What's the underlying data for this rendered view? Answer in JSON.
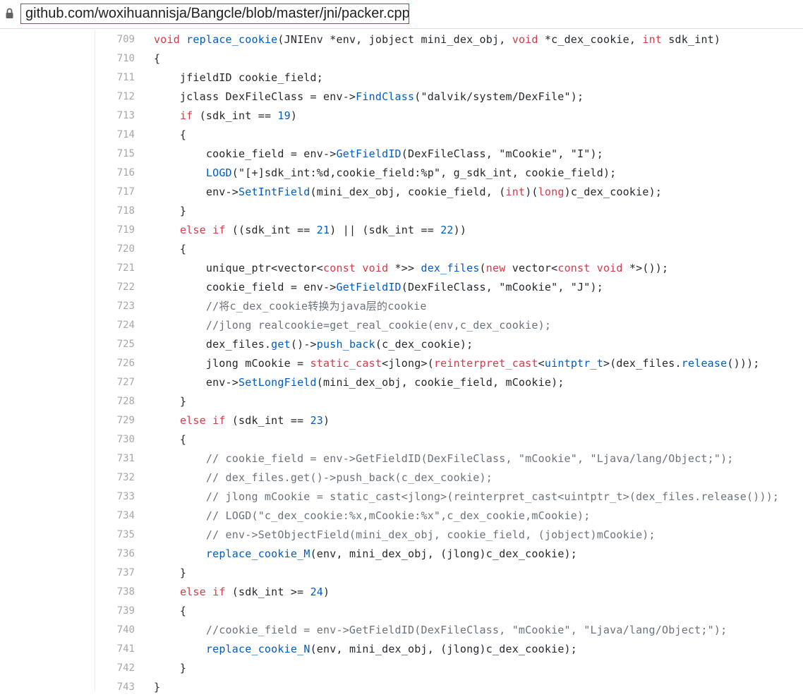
{
  "address_bar": {
    "url": "github.com/woxihuannisja/Bangcle/blob/master/jni/packer.cpp",
    "lock_icon": "lock-icon"
  },
  "code": {
    "lines": [
      {
        "n": "709",
        "tokens": [
          [
            "k",
            "void"
          ],
          [
            "p",
            " "
          ],
          [
            "f",
            "replace_cookie"
          ],
          [
            "p",
            "(JNIEnv *env, jobject mini_dex_obj, "
          ],
          [
            "k",
            "void"
          ],
          [
            "p",
            " *c_dex_cookie, "
          ],
          [
            "k",
            "int"
          ],
          [
            "p",
            " sdk_int)"
          ]
        ]
      },
      {
        "n": "710",
        "tokens": [
          [
            "p",
            "{"
          ]
        ]
      },
      {
        "n": "711",
        "tokens": [
          [
            "p",
            "    jfieldID cookie_field;"
          ]
        ]
      },
      {
        "n": "712",
        "tokens": [
          [
            "p",
            "    jclass DexFileClass = env->"
          ],
          [
            "f",
            "FindClass"
          ],
          [
            "p",
            "(\"dalvik/system/DexFile\");"
          ]
        ]
      },
      {
        "n": "713",
        "tokens": [
          [
            "p",
            "    "
          ],
          [
            "k",
            "if"
          ],
          [
            "p",
            " (sdk_int == "
          ],
          [
            "n",
            "19"
          ],
          [
            "p",
            ")"
          ]
        ]
      },
      {
        "n": "714",
        "tokens": [
          [
            "p",
            "    {"
          ]
        ]
      },
      {
        "n": "715",
        "tokens": [
          [
            "p",
            "        cookie_field = env->"
          ],
          [
            "f",
            "GetFieldID"
          ],
          [
            "p",
            "(DexFileClass, \"mCookie\", \"I\");"
          ]
        ]
      },
      {
        "n": "716",
        "tokens": [
          [
            "p",
            "        "
          ],
          [
            "f",
            "LOGD"
          ],
          [
            "p",
            "(\"[+]sdk_int:%d,cookie_field:%p\", g_sdk_int, cookie_field);"
          ]
        ]
      },
      {
        "n": "717",
        "tokens": [
          [
            "p",
            "        env->"
          ],
          [
            "f",
            "SetIntField"
          ],
          [
            "p",
            "(mini_dex_obj, cookie_field, ("
          ],
          [
            "k",
            "int"
          ],
          [
            "p",
            ")("
          ],
          [
            "k",
            "long"
          ],
          [
            "p",
            ")c_dex_cookie);"
          ]
        ]
      },
      {
        "n": "718",
        "tokens": [
          [
            "p",
            "    }"
          ]
        ]
      },
      {
        "n": "719",
        "tokens": [
          [
            "p",
            "    "
          ],
          [
            "k",
            "else if"
          ],
          [
            "p",
            " ((sdk_int == "
          ],
          [
            "n",
            "21"
          ],
          [
            "p",
            ") || (sdk_int == "
          ],
          [
            "n",
            "22"
          ],
          [
            "p",
            "))"
          ]
        ]
      },
      {
        "n": "720",
        "tokens": [
          [
            "p",
            "    {"
          ]
        ]
      },
      {
        "n": "721",
        "tokens": [
          [
            "p",
            "        unique_ptr<vector<"
          ],
          [
            "k",
            "const void"
          ],
          [
            "p",
            " *>> "
          ],
          [
            "f",
            "dex_files"
          ],
          [
            "p",
            "("
          ],
          [
            "k",
            "new"
          ],
          [
            "p",
            " vector<"
          ],
          [
            "k",
            "const void"
          ],
          [
            "p",
            " *>());"
          ]
        ]
      },
      {
        "n": "722",
        "tokens": [
          [
            "p",
            "        cookie_field = env->"
          ],
          [
            "f",
            "GetFieldID"
          ],
          [
            "p",
            "(DexFileClass, \"mCookie\", \"J\");"
          ]
        ]
      },
      {
        "n": "723",
        "tokens": [
          [
            "c",
            "        //将c_dex_cookie转换为java层的cookie"
          ]
        ]
      },
      {
        "n": "724",
        "tokens": [
          [
            "c",
            "        //jlong realcookie=get_real_cookie(env,c_dex_cookie);"
          ]
        ]
      },
      {
        "n": "725",
        "tokens": [
          [
            "p",
            "        dex_files."
          ],
          [
            "f",
            "get"
          ],
          [
            "p",
            "()->"
          ],
          [
            "f",
            "push_back"
          ],
          [
            "p",
            "(c_dex_cookie);"
          ]
        ]
      },
      {
        "n": "726",
        "tokens": [
          [
            "p",
            "        jlong mCookie = "
          ],
          [
            "k",
            "static_cast"
          ],
          [
            "p",
            "<jlong>("
          ],
          [
            "k",
            "reinterpret_cast"
          ],
          [
            "p",
            "<"
          ],
          [
            "f",
            "uintptr_t"
          ],
          [
            "p",
            ">(dex_files."
          ],
          [
            "f",
            "release"
          ],
          [
            "p",
            "()));"
          ]
        ]
      },
      {
        "n": "727",
        "tokens": [
          [
            "p",
            "        env->"
          ],
          [
            "f",
            "SetLongField"
          ],
          [
            "p",
            "(mini_dex_obj, cookie_field, mCookie);"
          ]
        ]
      },
      {
        "n": "728",
        "tokens": [
          [
            "p",
            "    }"
          ]
        ]
      },
      {
        "n": "729",
        "tokens": [
          [
            "p",
            "    "
          ],
          [
            "k",
            "else if"
          ],
          [
            "p",
            " (sdk_int == "
          ],
          [
            "n",
            "23"
          ],
          [
            "p",
            ")"
          ]
        ]
      },
      {
        "n": "730",
        "tokens": [
          [
            "p",
            "    {"
          ]
        ]
      },
      {
        "n": "731",
        "tokens": [
          [
            "c",
            "        // cookie_field = env->GetFieldID(DexFileClass, \"mCookie\", \"Ljava/lang/Object;\");"
          ]
        ]
      },
      {
        "n": "732",
        "tokens": [
          [
            "c",
            "        // dex_files.get()->push_back(c_dex_cookie);"
          ]
        ]
      },
      {
        "n": "733",
        "tokens": [
          [
            "c",
            "        // jlong mCookie = static_cast<jlong>(reinterpret_cast<uintptr_t>(dex_files.release()));"
          ]
        ]
      },
      {
        "n": "734",
        "tokens": [
          [
            "c",
            "        // LOGD(\"c_dex_cookie:%x,mCookie:%x\",c_dex_cookie,mCookie);"
          ]
        ]
      },
      {
        "n": "735",
        "tokens": [
          [
            "c",
            "        // env->SetObjectField(mini_dex_obj, cookie_field, (jobject)mCookie);"
          ]
        ]
      },
      {
        "n": "736",
        "tokens": [
          [
            "p",
            "        "
          ],
          [
            "f",
            "replace_cookie_M"
          ],
          [
            "p",
            "(env, mini_dex_obj, (jlong)c_dex_cookie);"
          ]
        ]
      },
      {
        "n": "737",
        "tokens": [
          [
            "p",
            "    }"
          ]
        ]
      },
      {
        "n": "738",
        "tokens": [
          [
            "p",
            "    "
          ],
          [
            "k",
            "else if"
          ],
          [
            "p",
            " (sdk_int >= "
          ],
          [
            "n",
            "24"
          ],
          [
            "p",
            ")"
          ]
        ]
      },
      {
        "n": "739",
        "tokens": [
          [
            "p",
            "    {"
          ]
        ]
      },
      {
        "n": "740",
        "tokens": [
          [
            "c",
            "        //cookie_field = env->GetFieldID(DexFileClass, \"mCookie\", \"Ljava/lang/Object;\");"
          ]
        ]
      },
      {
        "n": "741",
        "tokens": [
          [
            "p",
            "        "
          ],
          [
            "f",
            "replace_cookie_N"
          ],
          [
            "p",
            "(env, mini_dex_obj, (jlong)c_dex_cookie);"
          ]
        ]
      },
      {
        "n": "742",
        "tokens": [
          [
            "p",
            "    }"
          ]
        ]
      },
      {
        "n": "743",
        "tokens": [
          [
            "p",
            "}"
          ]
        ]
      }
    ]
  }
}
